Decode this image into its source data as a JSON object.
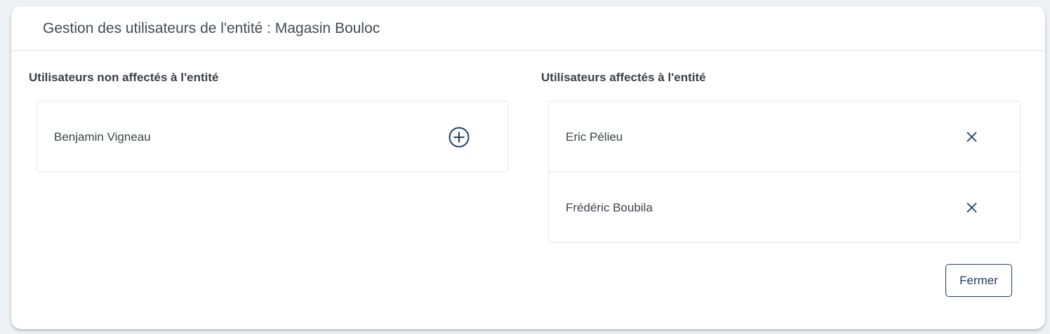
{
  "modal": {
    "title": "Gestion des utilisateurs de l'entité : Magasin Bouloc"
  },
  "unassigned": {
    "title": "Utilisateurs non affectés à l'entité",
    "users": [
      {
        "name": "Benjamin Vigneau",
        "action_icon": "plus-circle-icon"
      }
    ]
  },
  "assigned": {
    "title": "Utilisateurs affectés à l'entité",
    "users": [
      {
        "name": "Eric Pélieu",
        "action_icon": "close-icon"
      },
      {
        "name": "Frédéric Boubila",
        "action_icon": "close-icon"
      }
    ]
  },
  "footer": {
    "close_label": "Fermer"
  },
  "colors": {
    "accent": "#1f3d66",
    "border": "#e4e7eb",
    "background": "#eef1f4"
  }
}
